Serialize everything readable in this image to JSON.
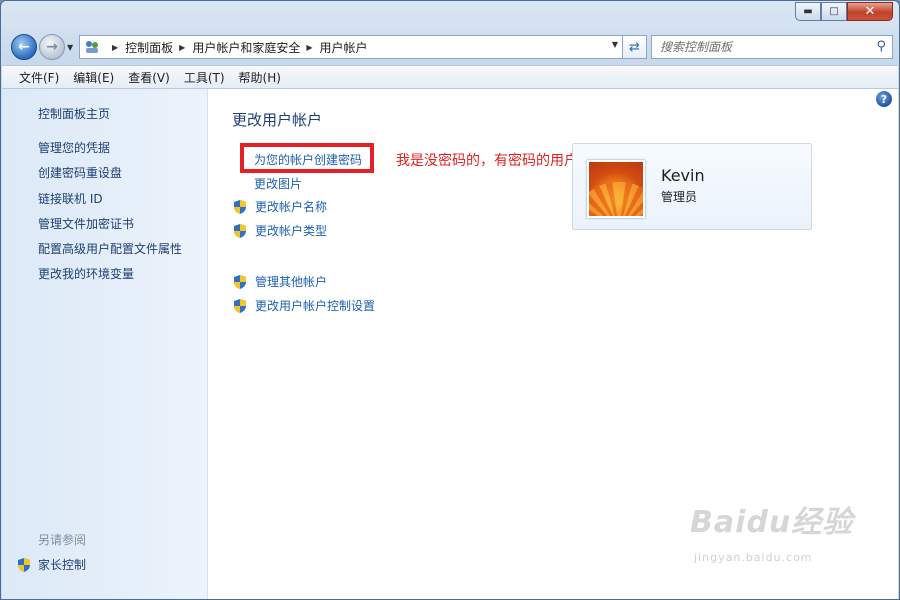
{
  "window": {
    "caption_buttons": {
      "minimize_icon": "minimize-icon",
      "maximize_icon": "maximize-icon",
      "close_icon": "close-icon"
    }
  },
  "nav": {
    "breadcrumb": [
      "控制面板",
      "用户帐户和家庭安全",
      "用户帐户"
    ],
    "search_placeholder": "搜索控制面板"
  },
  "menubar": {
    "items": [
      "文件(F)",
      "编辑(E)",
      "查看(V)",
      "工具(T)",
      "帮助(H)"
    ]
  },
  "sidebar": {
    "home": "控制面板主页",
    "links": [
      "管理您的凭据",
      "创建密码重设盘",
      "链接联机 ID",
      "管理文件加密证书",
      "配置高级用户配置文件属性",
      "更改我的环境变量"
    ],
    "see_also": "另请参阅",
    "parental_controls": "家长控制"
  },
  "main": {
    "title": "更改用户帐户",
    "tasks": [
      {
        "label": "为您的帐户创建密码",
        "shield": false
      },
      {
        "label": "更改图片",
        "shield": false
      },
      {
        "label": "更改帐户名称",
        "shield": true
      },
      {
        "label": "更改帐户类型",
        "shield": true
      }
    ],
    "other_tasks": [
      {
        "label": "管理其他帐户",
        "shield": true
      },
      {
        "label": "更改用户帐户控制设置",
        "shield": true
      }
    ],
    "annotation": "我是没密码的，有密码的用户这写的是更改密码!",
    "annotation_color": "#e02020"
  },
  "user": {
    "name": "Kevin",
    "role": "管理员"
  },
  "watermark": {
    "brand": "Baidu经验",
    "url": "jingyan.baidu.com"
  },
  "colors": {
    "link": "#1c5fb4",
    "sidebar_link": "#1e3f73",
    "highlight_box": "#e32127"
  }
}
